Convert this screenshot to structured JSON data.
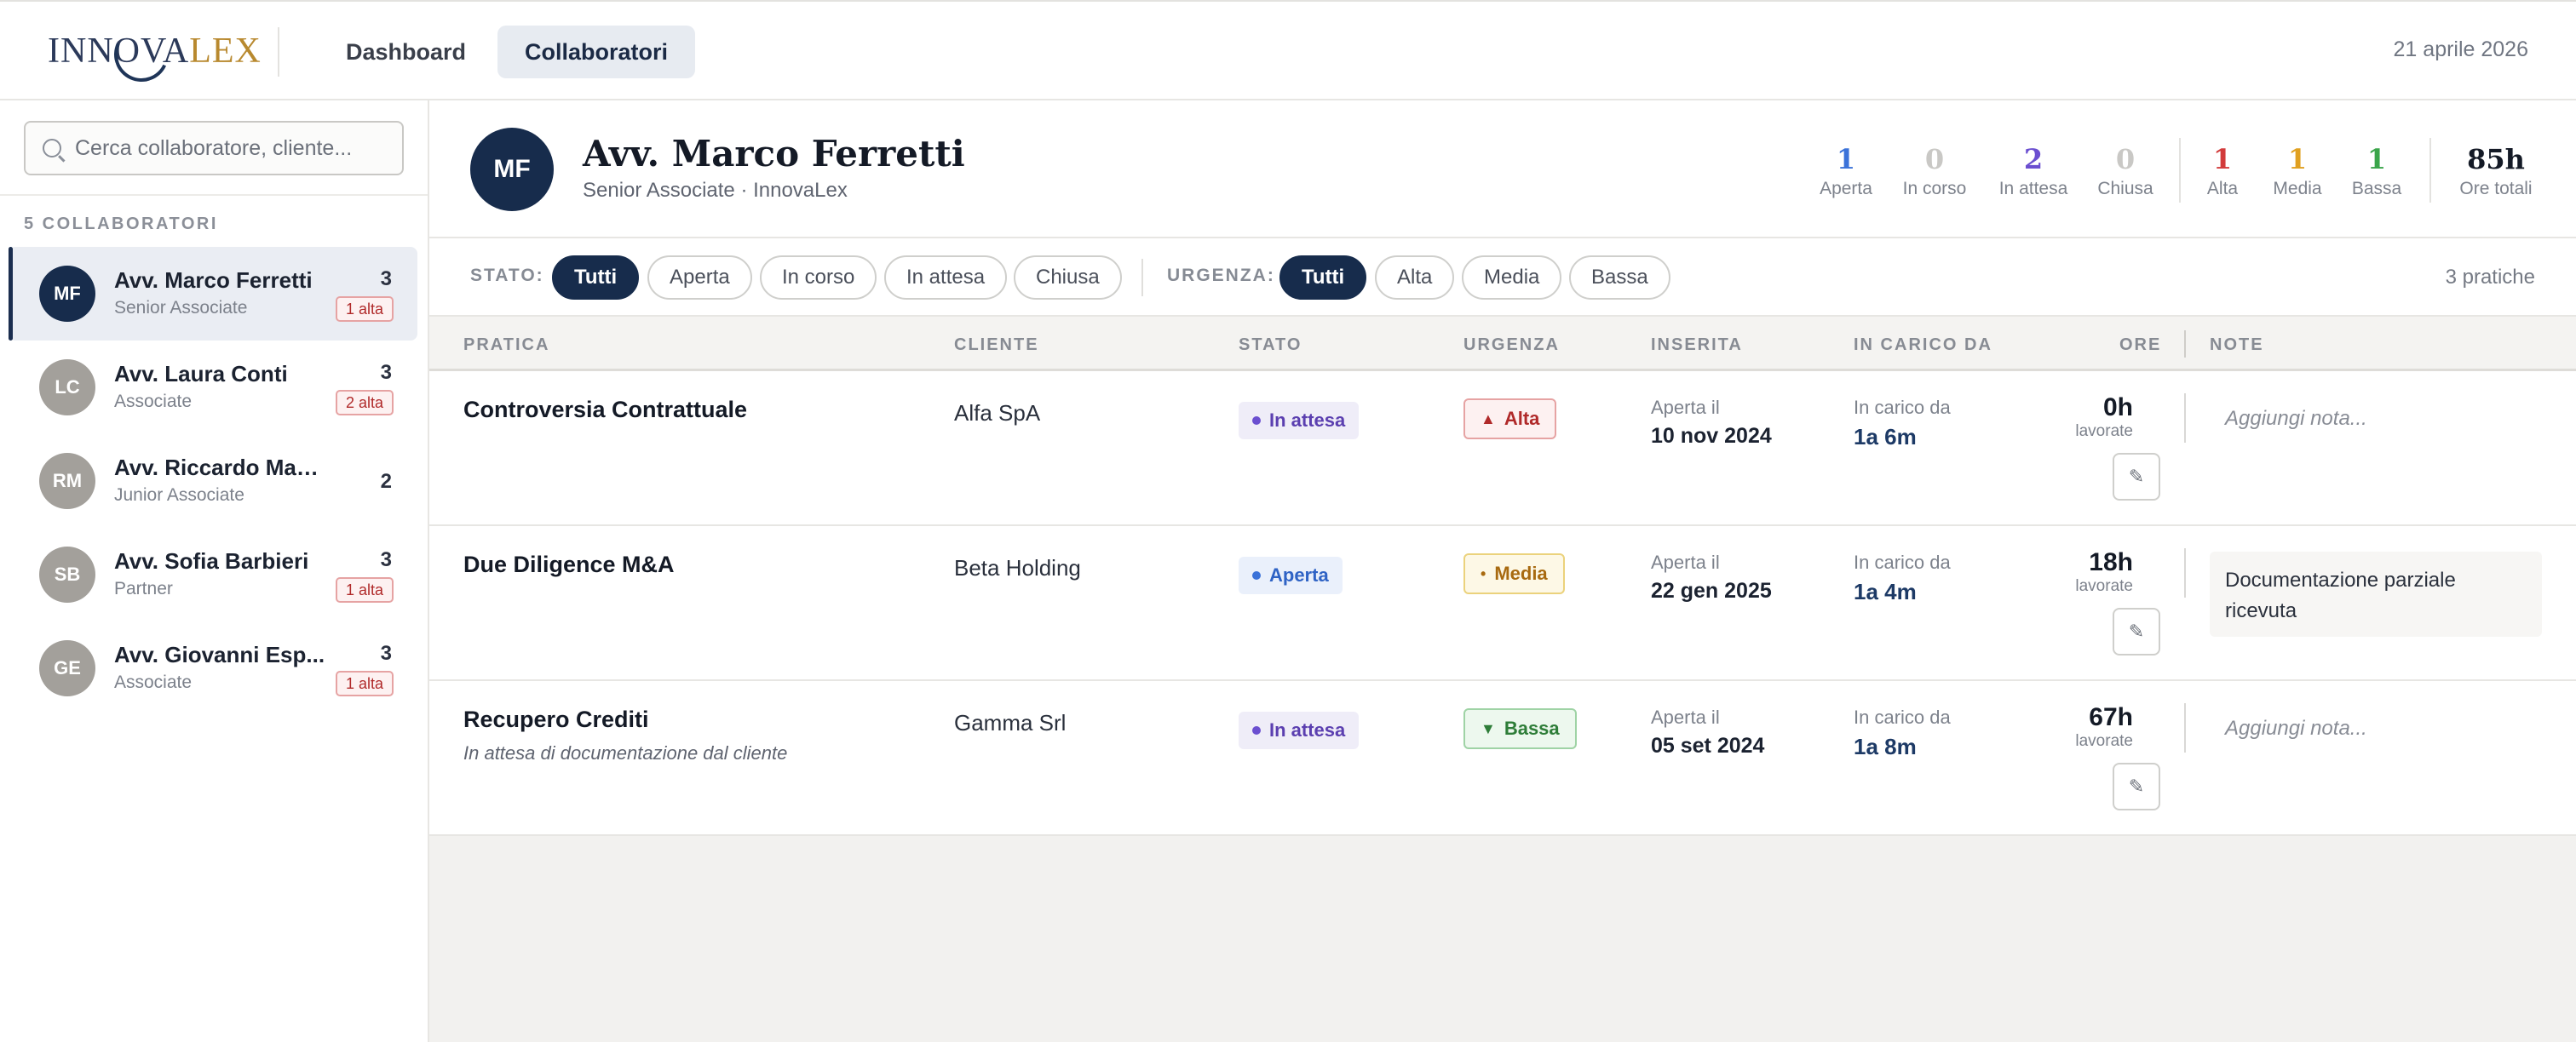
{
  "header": {
    "logo": "INNOVALEX",
    "logo_a": "INNO",
    "logo_b": "VA",
    "logo_c": "LEX",
    "nav": [
      "Dashboard",
      "Collaboratori"
    ],
    "date": "21 aprile 2026"
  },
  "sidebar": {
    "search_placeholder": "Cerca collaboratore, cliente...",
    "count_label": "5 COLLABORATORI",
    "items": [
      {
        "initials": "MF",
        "name": "Avv. Marco Ferretti",
        "role": "Senior Associate",
        "count": "3",
        "badge": "1 alta",
        "color": "#172c4c"
      },
      {
        "initials": "LC",
        "name": "Avv. Laura Conti",
        "role": "Associate",
        "count": "3",
        "badge": "2 alta",
        "color": "#a3a09b"
      },
      {
        "initials": "RM",
        "name": "Avv. Riccardo Mancini",
        "role": "Junior Associate",
        "count": "2",
        "badge": "",
        "color": "#a3a09b"
      },
      {
        "initials": "SB",
        "name": "Avv. Sofia Barbieri",
        "role": "Partner",
        "count": "3",
        "badge": "1 alta",
        "color": "#a3a09b"
      },
      {
        "initials": "GE",
        "name": "Avv. Giovanni Esp...",
        "role": "Associate",
        "count": "3",
        "badge": "1 alta",
        "color": "#a3a09b"
      }
    ]
  },
  "profile": {
    "initials": "MF",
    "name": "Avv. Marco Ferretti",
    "role": "Senior Associate · InnovaLex",
    "stats": [
      {
        "value": "1",
        "label": "Aperta",
        "color": "#3b72d9"
      },
      {
        "value": "0",
        "label": "In corso",
        "color": "#c9c8c5"
      },
      {
        "value": "2",
        "label": "In attesa",
        "color": "#6b4fd0"
      },
      {
        "value": "0",
        "label": "Chiusa",
        "color": "#c9c8c5"
      },
      {
        "value": "1",
        "label": "Alta",
        "color": "#d23b3b"
      },
      {
        "value": "1",
        "label": "Media",
        "color": "#e0a020"
      },
      {
        "value": "1",
        "label": "Bassa",
        "color": "#3aa54a"
      },
      {
        "value": "85h",
        "label": "Ore totali",
        "color": "#141a26"
      }
    ]
  },
  "filters": {
    "stato_label": "STATO:",
    "stato": [
      "Tutti",
      "Aperta",
      "In corso",
      "In attesa",
      "Chiusa"
    ],
    "urgenza_label": "URGENZA:",
    "urgenza": [
      "Tutti",
      "Alta",
      "Media",
      "Bassa"
    ],
    "count": "3 pratiche"
  },
  "table": {
    "headers": [
      "PRATICA",
      "CLIENTE",
      "STATO",
      "URGENZA",
      "INSERITA",
      "IN CARICO DA",
      "ORE",
      "NOTE"
    ],
    "rows": [
      {
        "title": "Controversia Contrattuale",
        "subtitle": "",
        "client": "Alfa SpA",
        "status": "In attesa",
        "urgency": "Alta",
        "urgency_icon": "▲",
        "ins_label": "Aperta il",
        "ins_date": "10 nov 2024",
        "car_label": "In carico da",
        "car_value": "1a 6m",
        "hours": "0h",
        "hours_label": "lavorate",
        "note": "Aggiungi nota..."
      },
      {
        "title": "Due Diligence M&A",
        "subtitle": "",
        "client": "Beta Holding",
        "status": "Aperta",
        "urgency": "Media",
        "urgency_icon": "•",
        "ins_label": "Aperta il",
        "ins_date": "22 gen 2025",
        "car_label": "In carico da",
        "car_value": "1a 4m",
        "hours": "18h",
        "hours_label": "lavorate",
        "note": "Documentazione parziale ricevuta"
      },
      {
        "title": "Recupero Crediti",
        "subtitle": "In attesa di documentazione dal cliente",
        "client": "Gamma Srl",
        "status": "In attesa",
        "urgency": "Bassa",
        "urgency_icon": "▼",
        "ins_label": "Aperta il",
        "ins_date": "05 set 2024",
        "car_label": "In carico da",
        "car_value": "1a 8m",
        "hours": "67h",
        "hours_label": "lavorate",
        "note": "Aggiungi nota..."
      }
    ]
  }
}
